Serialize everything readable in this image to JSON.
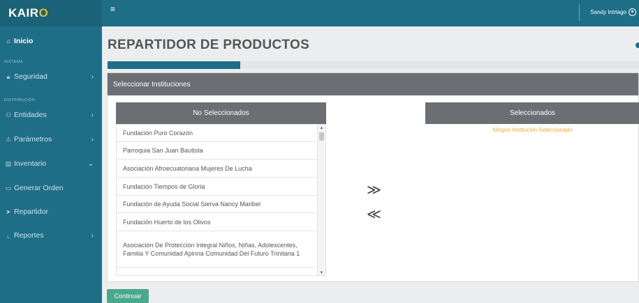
{
  "brand": {
    "prefix": "KAIR",
    "accent": "O"
  },
  "sidebar": {
    "home": "Inicio",
    "section_sistema": "SISTEMA",
    "seguridad": "Seguridad",
    "section_distribucion": "DISTRIBUCIÓN",
    "entidades": "Entidades",
    "parametros": "Parámetros",
    "inventario": "Inventario",
    "generar_orden": "Generar Orden",
    "repartidor": "Repartidor",
    "reportes": "Reportes"
  },
  "topbar": {
    "menu_icon": "≡",
    "user_name": "Sandy Intriago"
  },
  "page": {
    "title": "REPARTIDOR DE PRODUCTOS",
    "progress": 0.25
  },
  "panel": {
    "header": "Seleccionar Instituciones",
    "left_header": "No Seleccionados",
    "right_header": "Seleccionados",
    "empty_message": "Ningún Institución Seleccionado",
    "items": [
      "Fundación Puro Corazón",
      "Parroquia San Juan Bautista",
      "Asociación Afroecuatoriana Mujeres De Lucha",
      "Fundación Tiempos de Gloria",
      "Fundación de Ayuda Social Sierva Nancy Maribel",
      "Fundación Huerto de los Olivos",
      "Asociación De Protección Integral Niños, Niñas, Adolescentes, Familia Y Comunidad Apinna Comunidad Del Futuro Trinitaria 1"
    ],
    "add_arrow": "≫",
    "remove_arrow": "≪"
  },
  "continue_label": "Continuar",
  "colors": {
    "primary": "#1f6e87",
    "accent": "#f0b429",
    "panel_header": "#6b6f74",
    "button": "#4aa88b",
    "warning_text": "#f0a830"
  }
}
